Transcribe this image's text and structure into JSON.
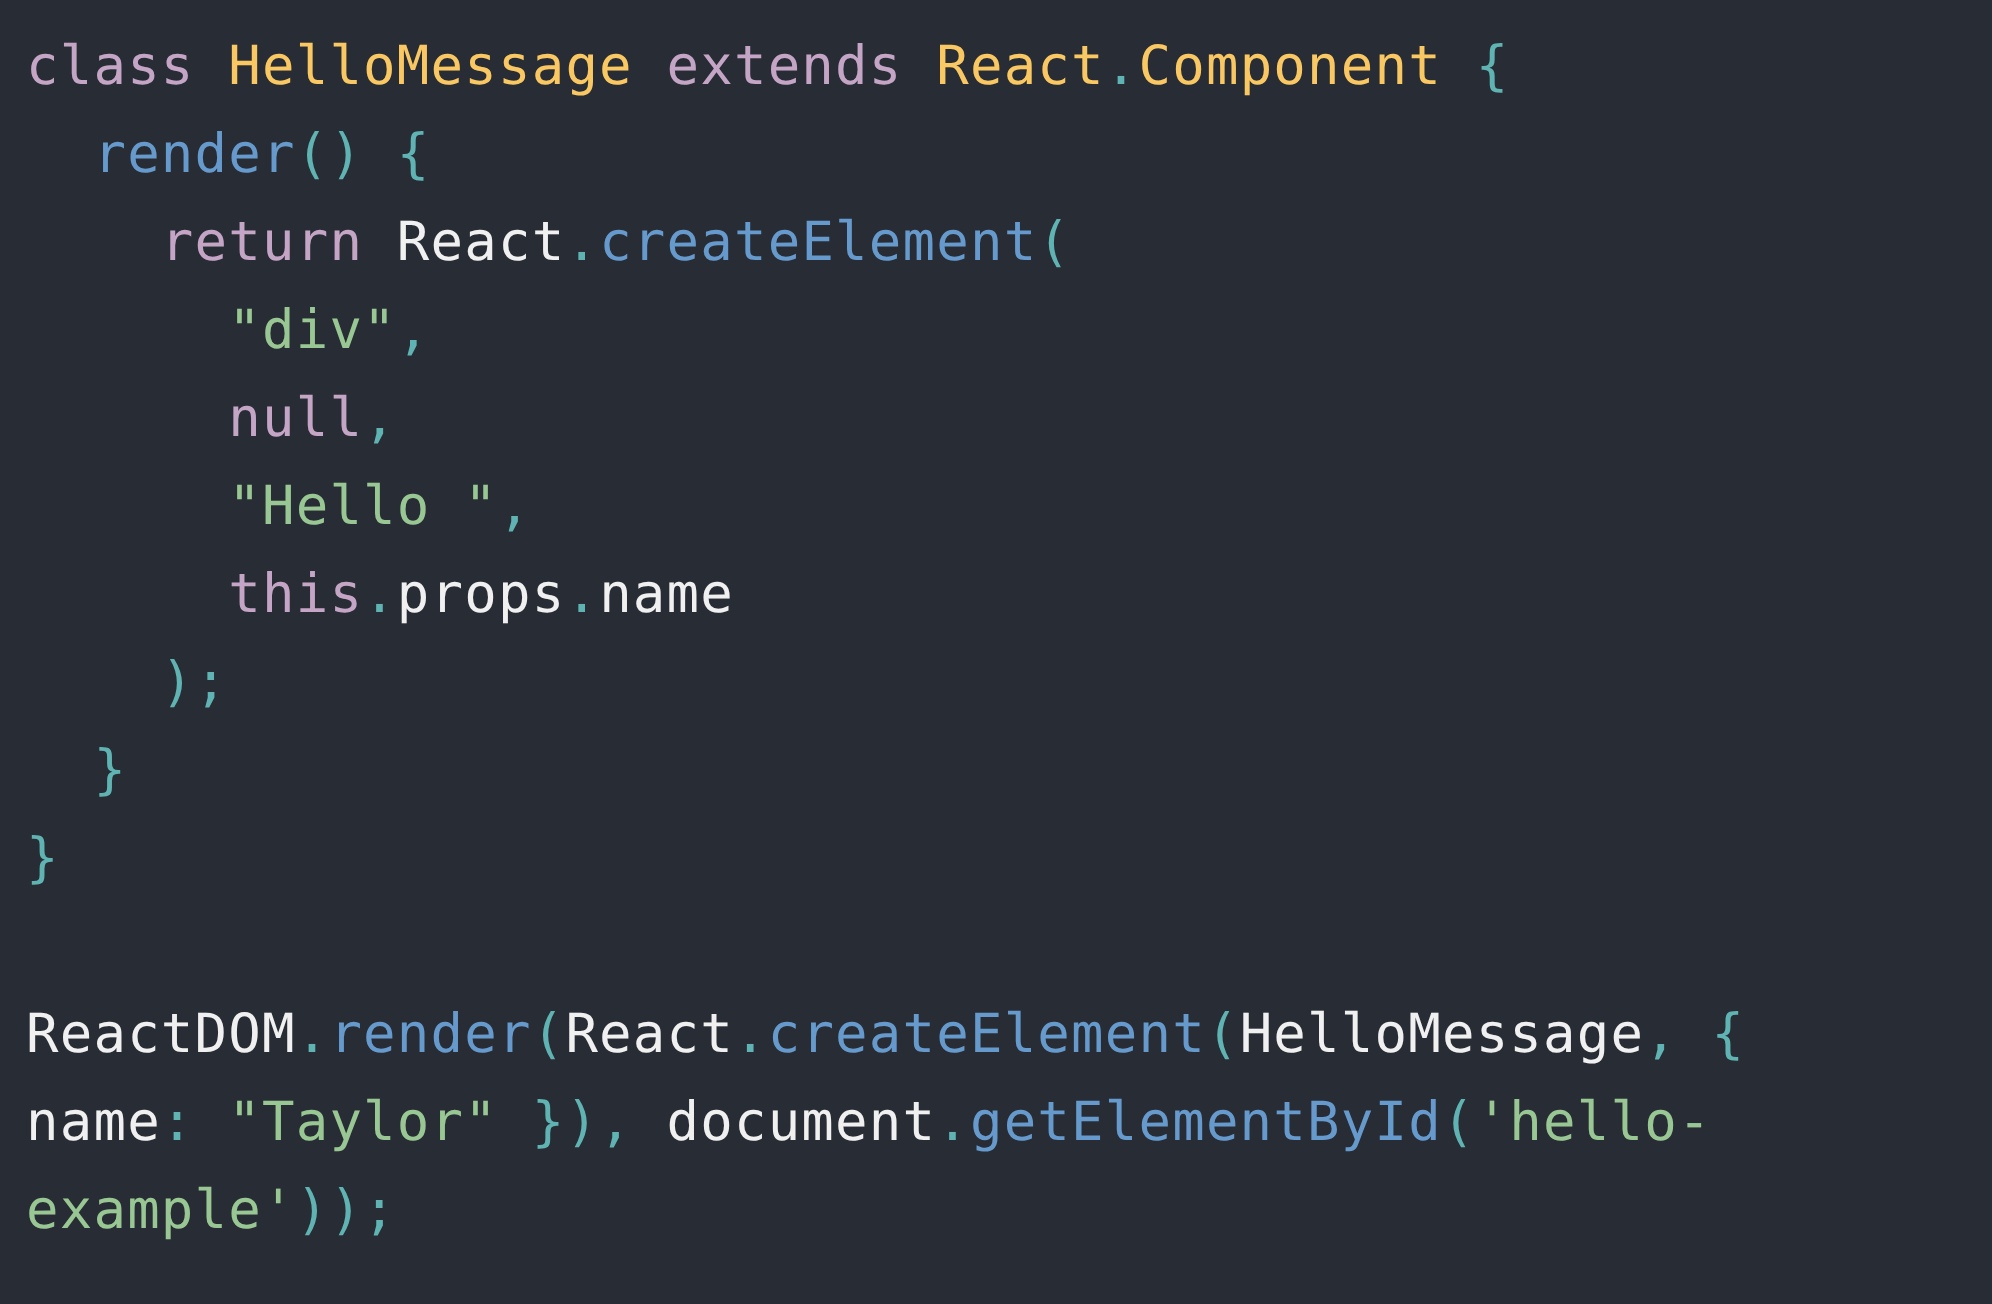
{
  "code_sections": [
    {
      "lines": [
        {
          "tokens": [
            {
              "text": "class ",
              "kind": "keyword"
            },
            {
              "text": "HelloMessage ",
              "kind": "class"
            },
            {
              "text": "extends ",
              "kind": "keyword"
            },
            {
              "text": "React",
              "kind": "class"
            },
            {
              "text": ".",
              "kind": "punct"
            },
            {
              "text": "Component ",
              "kind": "class"
            },
            {
              "text": "{",
              "kind": "punct"
            }
          ]
        },
        {
          "tokens": [
            {
              "text": "  render",
              "kind": "function"
            },
            {
              "text": "() {",
              "kind": "punct"
            }
          ]
        },
        {
          "tokens": [
            {
              "text": "    return ",
              "kind": "keyword"
            },
            {
              "text": "React",
              "kind": "plain"
            },
            {
              "text": ".",
              "kind": "punct"
            },
            {
              "text": "createElement",
              "kind": "function"
            },
            {
              "text": "(",
              "kind": "punct"
            }
          ]
        },
        {
          "tokens": [
            {
              "text": "      \"div\"",
              "kind": "string"
            },
            {
              "text": ",",
              "kind": "punct"
            }
          ]
        },
        {
          "tokens": [
            {
              "text": "      null",
              "kind": "keyword"
            },
            {
              "text": ",",
              "kind": "punct"
            }
          ]
        },
        {
          "tokens": [
            {
              "text": "      \"Hello \"",
              "kind": "string"
            },
            {
              "text": ",",
              "kind": "punct"
            }
          ]
        },
        {
          "tokens": [
            {
              "text": "      this",
              "kind": "keyword"
            },
            {
              "text": ".",
              "kind": "punct"
            },
            {
              "text": "props",
              "kind": "plain"
            },
            {
              "text": ".",
              "kind": "punct"
            },
            {
              "text": "name",
              "kind": "plain"
            }
          ]
        },
        {
          "tokens": [
            {
              "text": "    );",
              "kind": "punct"
            }
          ]
        },
        {
          "tokens": [
            {
              "text": "  }",
              "kind": "punct"
            }
          ]
        },
        {
          "tokens": [
            {
              "text": "}",
              "kind": "punct"
            }
          ]
        }
      ]
    },
    {
      "lines": [
        {
          "tokens": [
            {
              "text": "ReactDOM",
              "kind": "plain"
            },
            {
              "text": ".",
              "kind": "punct"
            },
            {
              "text": "render",
              "kind": "function"
            },
            {
              "text": "(",
              "kind": "punct"
            },
            {
              "text": "React",
              "kind": "plain"
            },
            {
              "text": ".",
              "kind": "punct"
            },
            {
              "text": "createElement",
              "kind": "function"
            },
            {
              "text": "(",
              "kind": "punct"
            },
            {
              "text": "HelloMessage",
              "kind": "plain"
            },
            {
              "text": ", {",
              "kind": "punct"
            }
          ]
        },
        {
          "tokens": [
            {
              "text": "name",
              "kind": "plain"
            },
            {
              "text": ": ",
              "kind": "punct"
            },
            {
              "text": "\"Taylor\"",
              "kind": "string"
            },
            {
              "text": " }), ",
              "kind": "punct"
            },
            {
              "text": "document",
              "kind": "plain"
            },
            {
              "text": ".",
              "kind": "punct"
            },
            {
              "text": "getElementById",
              "kind": "function"
            },
            {
              "text": "(",
              "kind": "punct"
            },
            {
              "text": "'hello-",
              "kind": "string"
            }
          ]
        },
        {
          "tokens": [
            {
              "text": "example'",
              "kind": "string"
            },
            {
              "text": "));",
              "kind": "punct"
            }
          ]
        }
      ]
    }
  ]
}
